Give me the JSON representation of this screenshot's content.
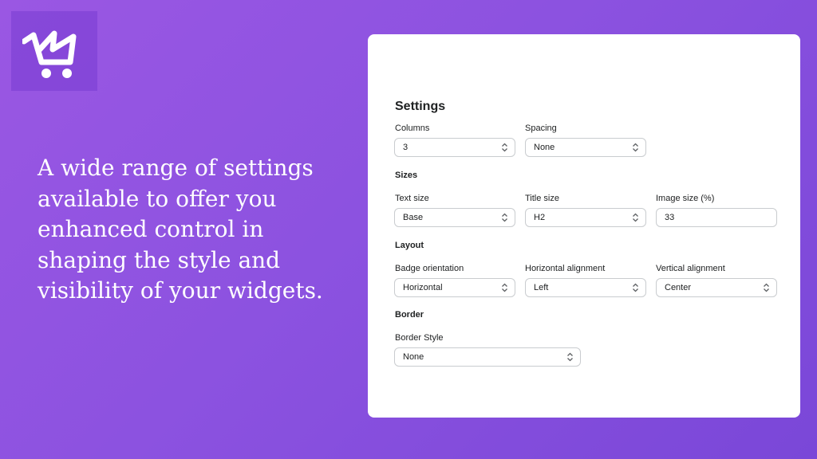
{
  "brand": {
    "logo_icon": "cart-icon"
  },
  "tagline": "A wide range of settings available to offer you enhanced control in shaping the style and visibility of your widgets.",
  "panel": {
    "title": "Settings",
    "columns": {
      "label": "Columns",
      "value": "3"
    },
    "spacing": {
      "label": "Spacing",
      "value": "None"
    },
    "sizes": {
      "heading": "Sizes",
      "text_size": {
        "label": "Text size",
        "value": "Base"
      },
      "title_size": {
        "label": "Title size",
        "value": "H2"
      },
      "image_size": {
        "label": "Image size (%)",
        "value": "33"
      }
    },
    "layout": {
      "heading": "Layout",
      "badge_orientation": {
        "label": "Badge orientation",
        "value": "Horizontal"
      },
      "horizontal_alignment": {
        "label": "Horizontal alignment",
        "value": "Left"
      },
      "vertical_alignment": {
        "label": "Vertical alignment",
        "value": "Center"
      }
    },
    "border": {
      "heading": "Border",
      "border_style": {
        "label": "Border Style",
        "value": "None"
      }
    }
  }
}
